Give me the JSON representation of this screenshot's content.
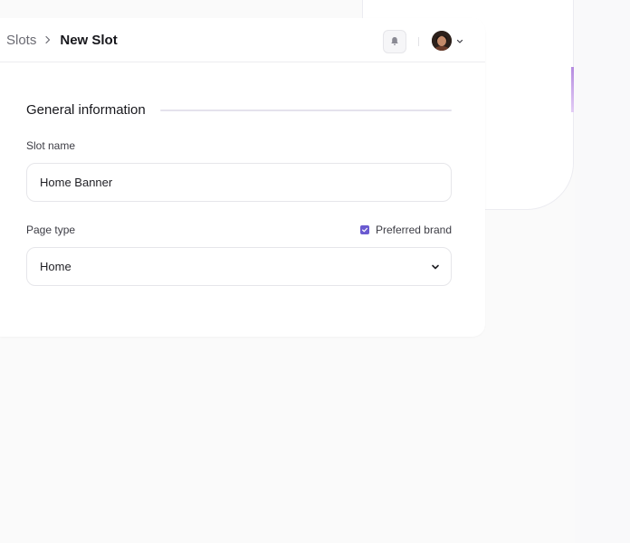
{
  "breadcrumb": {
    "root": "Slots",
    "current": "New Slot"
  },
  "header": {
    "notification_icon": "bell-icon",
    "user_menu_icon": "chevron-down-icon"
  },
  "form": {
    "section_title": "General information",
    "slot_name": {
      "label": "Slot name",
      "value": "Home Banner"
    },
    "page_type": {
      "label": "Page type",
      "value": "Home"
    },
    "preferred_brand": {
      "label": "Preferred brand",
      "checked": true
    }
  },
  "colors": {
    "accent": "#6a5ad0",
    "border": "#e6e6ea",
    "background": "#fafafa"
  }
}
